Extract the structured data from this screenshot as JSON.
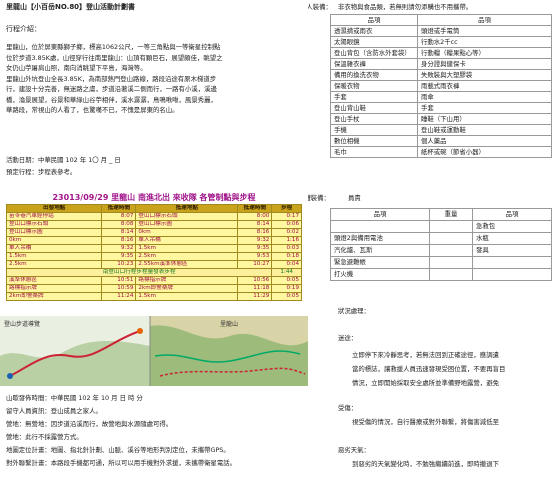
{
  "left": {
    "title": "里龍山【小百岳NO.80】登山活動計劃書",
    "intro_heading": "行程介紹：",
    "intro_lines": [
      "里龍山，位於屏東縣獅子鄉，標高1062公尺，一等三角點與一等衛星控制點",
      "位於步道3.85K處，山徑穿行往南里龍山：山頂有顆巨石，展望頗佳，眺望之",
      "女仍山苧屠肩山照，南向消眺望下平島，海灣等。",
      "里龍山外坑登山全長3.85K，為南部熱門登山路線，路段沿途有原木梯道步",
      "行，建設十分完善，無迷路之虞，步道沿著溪二側而行，一路有小溪，溪邊",
      "橋，淪景展望，谷景和華綠山谷苧相伴，溪水潺潺，鳥鳴啾啾，風景秀麗，",
      "華路段，常視山的人看了，也驚嘆不已，不愧是屏東的名山。"
    ],
    "date_line": "活動日期：中華民國 102 年 1〇 月 _ 日",
    "plan_line": "預定行程：步程表參考。",
    "itinerary": {
      "title": "23013/09/29 里龍山 南進北出 來收隊 各管制點與步程",
      "headers": [
        "出發地點",
        "抵達時間",
        "抵達地點",
        "抵達時間",
        "步程"
      ],
      "rows": [
        [
          "苗苓巷汽車經停站",
          "8:07",
          "登山口標示石頭",
          "8:00",
          "0:17"
        ],
        [
          "登山口標示石頭",
          "8:08",
          "登山口標示圖",
          "8:14",
          "0:06"
        ],
        [
          "登山口標示圖",
          "8:14",
          "0km",
          "8:16",
          "0:02"
        ],
        [
          "0km",
          "8:16",
          "單人吊橋",
          "9:32",
          "1:16"
        ],
        [
          "單人吊橋",
          "9:32",
          "1.5km",
          "9:35",
          "0:03"
        ],
        [
          "1.5km",
          "9:35",
          "2.5km",
          "9:53",
          "0:18"
        ],
        [
          "2.5km",
          "10:23",
          "2.55km溪準休憩區",
          "10:27",
          "0:04"
        ]
      ],
      "bar_text": "南登山口行程步程量發表步程",
      "bar_time": "1:44",
      "rows2": [
        [
          "溪準休憩區",
          "10:51",
          "路標指示牌",
          "10:56",
          "0:05"
        ],
        [
          "路標指示牌",
          "10:59",
          "2km即警桑牌",
          "11:18",
          "0:19"
        ],
        [
          "2km即警桑牌",
          "11:24",
          "1.5km",
          "11:29",
          "0:05"
        ]
      ]
    },
    "maps": {
      "left_label": "登山步道導覽",
      "right_label": "里龍山"
    },
    "after_lines": [
      "山歇發佈時間：中華民國 102 年 10 月 日 時 分",
      "留守人員資訊：登山成員之家人。",
      "營地：無營地：因步道沿溪而行，故營地與水源隨處可得。",
      "營地：此行不採露營方式。",
      "地圖定位計畫：地圖、指北針計劃、山脈、溪谷等地形判別定位，未攜帶GPS。",
      "對外聯繫計畫：本路段手機都可通，所以可以用手機對外求援，未攜帶衛星電話。"
    ]
  },
  "right": {
    "gear_heading": "個人裝備：",
    "gear_note": "非衣物與食品類，若無則請勿添購也不用攜帶。",
    "gear_headers": [
      "品項",
      "品項"
    ],
    "gear_rows": [
      [
        "透濕揹或雨衣",
        "頭燈或手電筒"
      ],
      [
        "太陽眼鏡",
        "行動水2千cc"
      ],
      [
        "登山背包（含防水外套袋）",
        "行動糧（糧果點心等）"
      ],
      [
        "保溫雜衣褲",
        "身分證與健保卡"
      ],
      [
        "備用的換洗衣物",
        "失敗裝與大塑膠袋"
      ],
      [
        "保暖衣物",
        "雨載式雨衣褲"
      ],
      [
        "手套",
        "雨傘"
      ],
      [
        "登山背山鞋",
        "手套"
      ],
      [
        "登山手杖",
        "睡鞋（下山用）"
      ],
      [
        "手機",
        "登山鞋或運動鞋"
      ],
      [
        "數位相機",
        "個人藥品"
      ],
      [
        "毛巾",
        "紙杯或碗（節省小器）"
      ]
    ],
    "public_heading": "團體裝備：",
    "public_sub": "員責",
    "public_headers": [
      "品項",
      "重量",
      "品項"
    ],
    "public_rows": [
      [
        "",
        "",
        "急救包"
      ],
      [
        "頭燈2與備用電池",
        "",
        "水瓶"
      ],
      [
        "汽化爐、瓦斯",
        "",
        "發具"
      ],
      [
        "緊急避難帳",
        "",
        ""
      ],
      [
        "打火機",
        "",
        ""
      ]
    ],
    "emergency_heading": "狀況處理：",
    "lost_heading": "迷途：",
    "lost_lines": [
      "立即停下來冷靜思考，若無法回到正確途徑，應調遣",
      "當的標誌，讓救援人員迅速發現受困位置，不要再盲目",
      "情況，立即開始採取安全處所並準備野地露營，避免"
    ],
    "injury_heading": "受傷：",
    "injury_lines": [
      "視受傷的情況，自行醫療或對外聯繫，將傷害減低至"
    ],
    "weather_heading": "惡劣天氣：",
    "weather_lines": [
      "到惡劣的天氣變化時，不勉強繼續前進，即時撤退下"
    ]
  }
}
